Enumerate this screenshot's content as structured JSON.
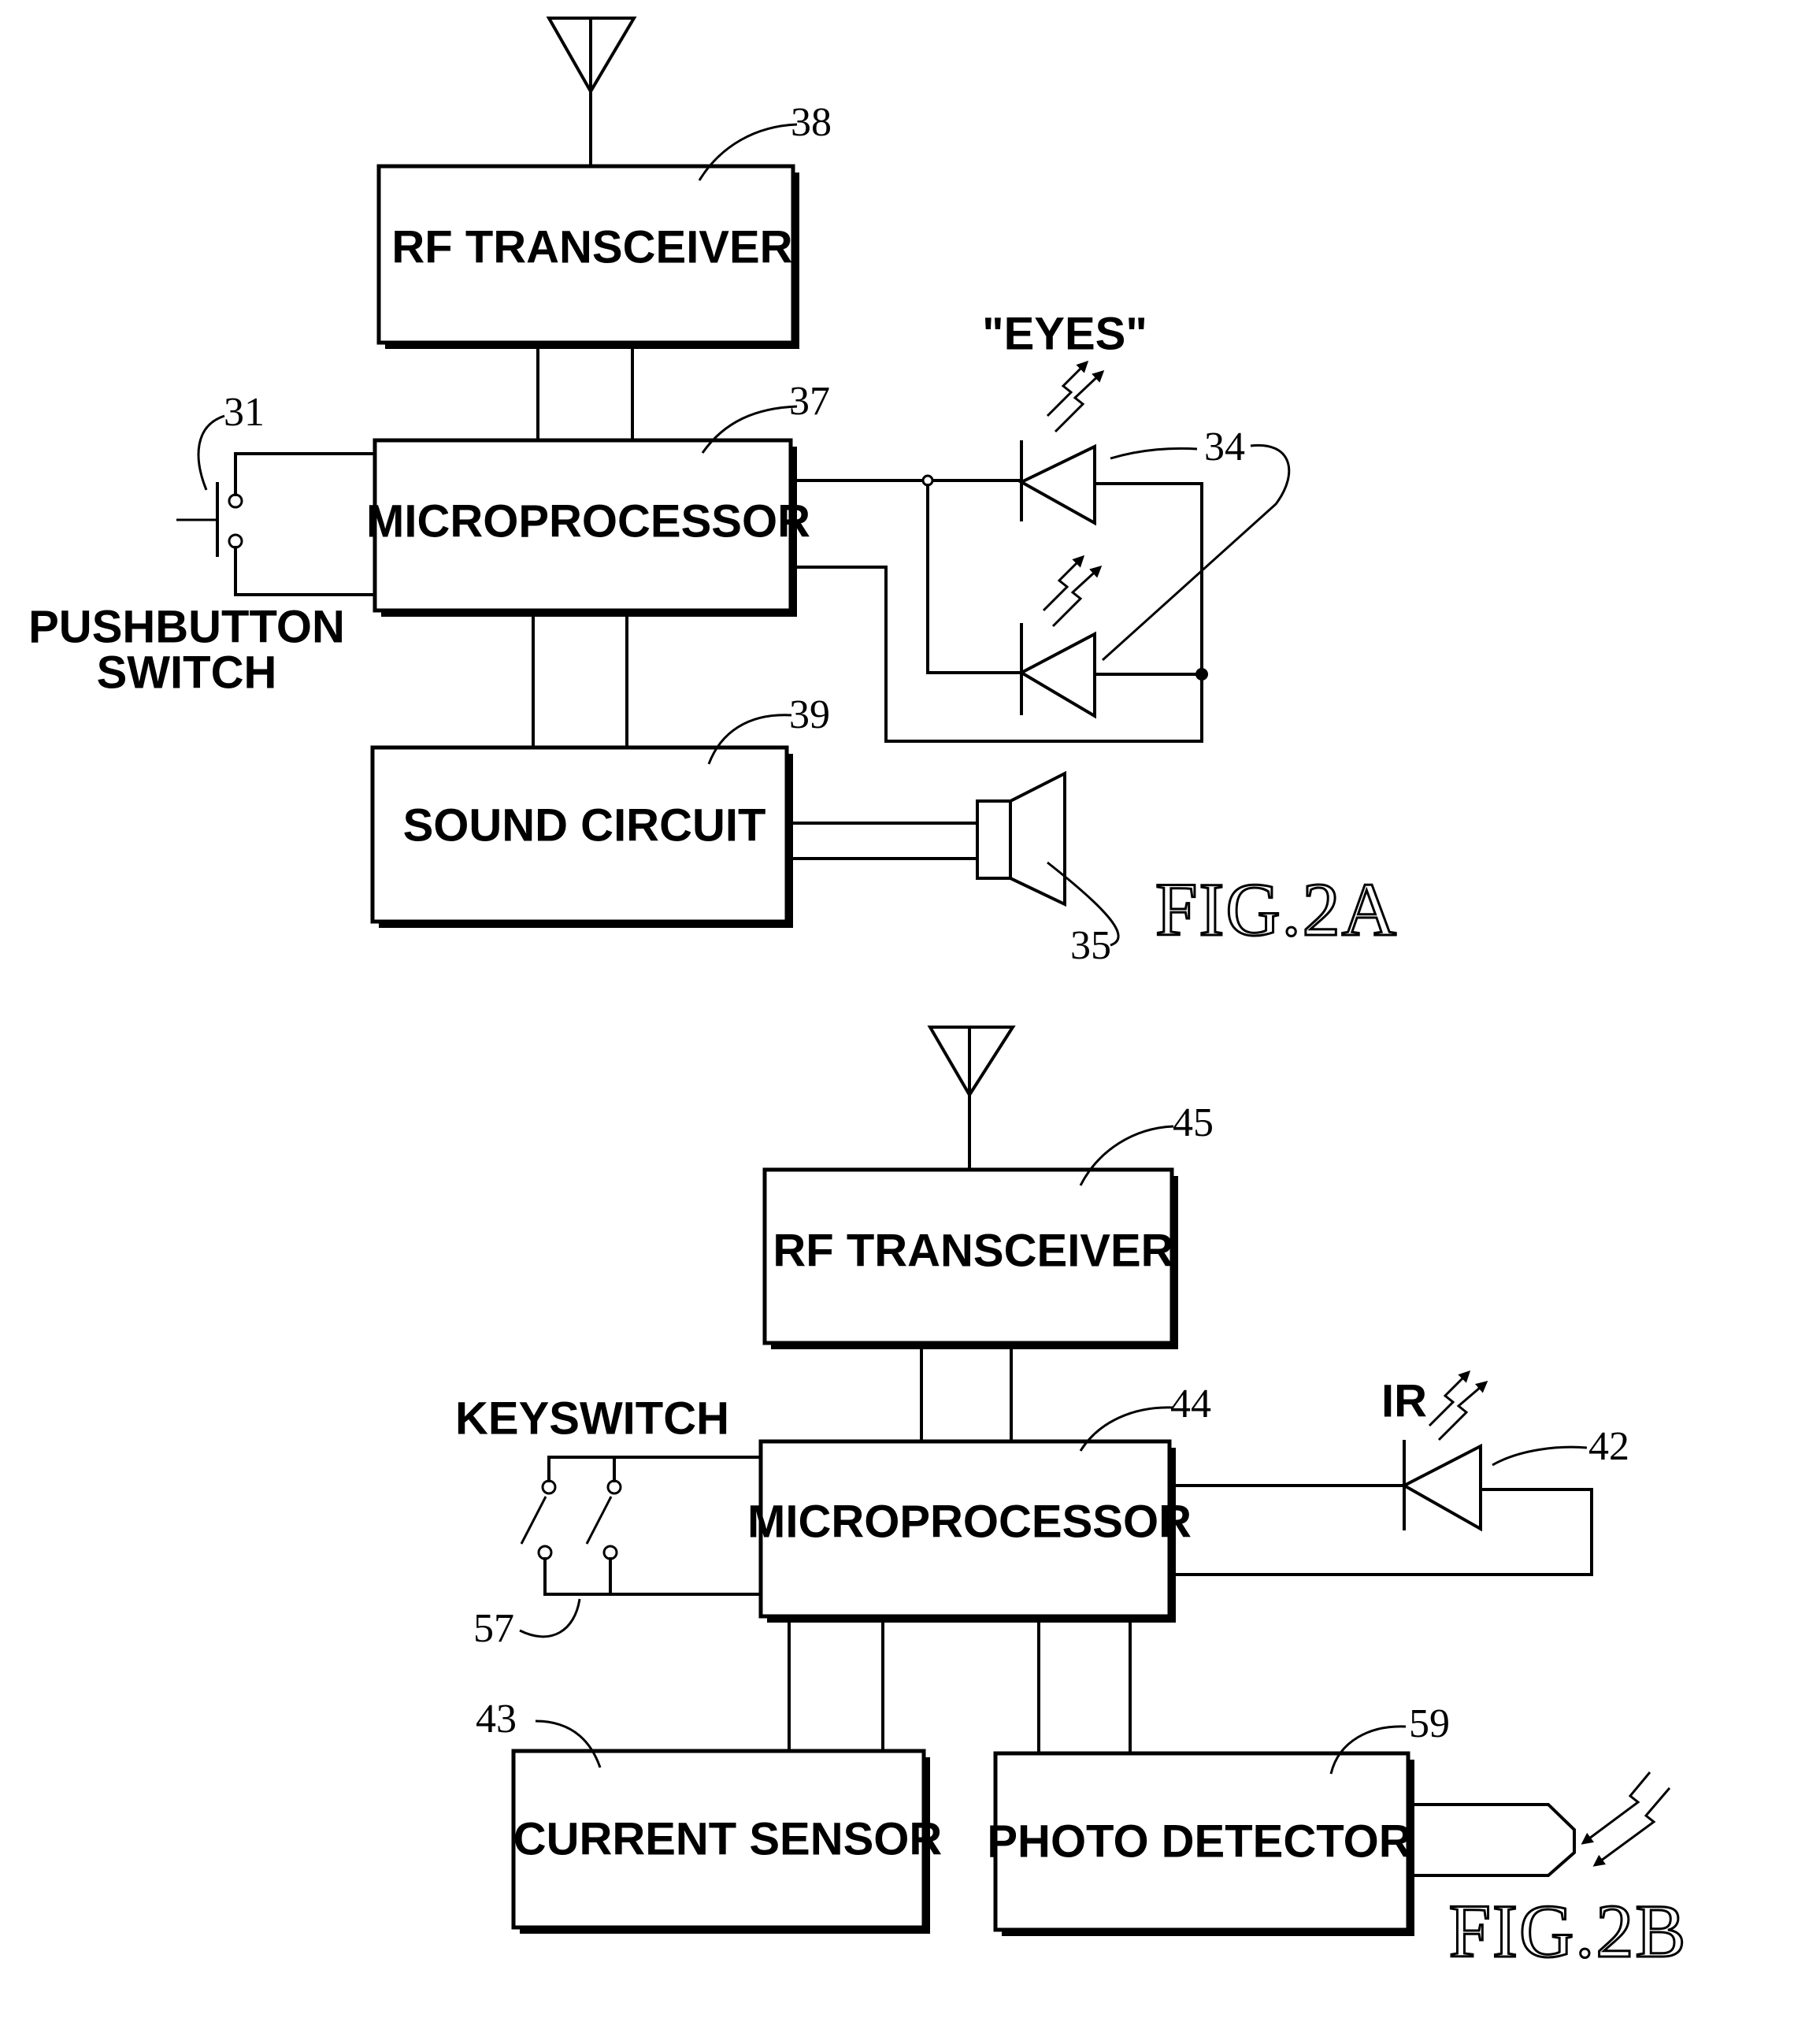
{
  "fig2a": {
    "caption": "FIG.2A",
    "rf_transceiver": {
      "label": "RF TRANSCEIVER",
      "ref": "38"
    },
    "microprocessor": {
      "label": "MICROPROCESSOR",
      "ref": "37"
    },
    "sound_circuit": {
      "label": "SOUND CIRCUIT",
      "ref": "39"
    },
    "pushbutton": {
      "label_line1": "PUSHBUTTON",
      "label_line2": "SWITCH",
      "ref": "31"
    },
    "eyes": {
      "label": "\"EYES\"",
      "ref": "34"
    },
    "speaker": {
      "ref": "35"
    }
  },
  "fig2b": {
    "caption": "FIG.2B",
    "rf_transceiver": {
      "label": "RF TRANSCEIVER",
      "ref": "45"
    },
    "microprocessor": {
      "label": "MICROPROCESSOR",
      "ref": "44"
    },
    "keyswitch": {
      "label": "KEYSWITCH",
      "ref": "57"
    },
    "ir_led": {
      "label": "IR",
      "ref": "42"
    },
    "current_sensor": {
      "label": "CURRENT SENSOR",
      "ref": "43"
    },
    "photo_detector": {
      "label": "PHOTO DETECTOR",
      "ref": "59"
    }
  }
}
